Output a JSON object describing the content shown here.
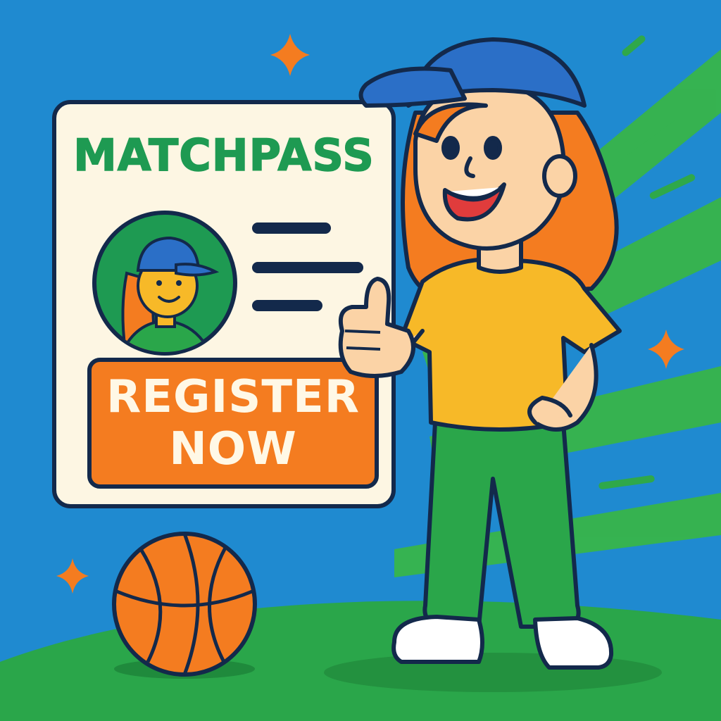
{
  "card": {
    "brand": "MATCHPASS",
    "button_label": "REGISTER\nNOW"
  },
  "icons": {
    "sparkle": "sparkle-icon",
    "basketball": "basketball-icon",
    "thumbs_up": "thumbs-up-icon"
  },
  "colors": {
    "sky": "#1f8ad0",
    "grass": "#2aa64a",
    "brand_green": "#1e9a52",
    "button_orange": "#f47c20",
    "card_cream": "#fdf6e3",
    "outline": "#13294b",
    "cap_blue": "#2b6fc7",
    "shirt_yellow": "#f7b928"
  }
}
